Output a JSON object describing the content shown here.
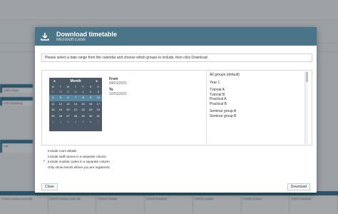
{
  "background": {
    "events": [
      {
        "text": "CSE1 Pract"
      },
      {
        "text": "CS2 Workshop"
      },
      {
        "text": "Lab"
      }
    ],
    "bottom_cells": [
      "CS101 Lecture room 4B",
      "CS102 Lecture room 4B",
      "CS103 Tutorial",
      "CS104 Practical",
      "CS105 Lecture",
      "CS106 Lecture",
      "CS107 Seminar"
    ]
  },
  "modal": {
    "title": "Download timetable",
    "subtitle": "Microsoft Excel",
    "info_text": "Please select a date range from the calendar and choose which groups to include, then click Download.",
    "calendar": {
      "month_label": "Month",
      "prev_icon": "chevron-left-icon",
      "next_icon": "chevron-right-icon",
      "dow": [
        "M",
        "T",
        "W",
        "T",
        "F",
        "S",
        "S"
      ],
      "days": [
        {
          "d": "27",
          "muted": true
        },
        {
          "d": "28",
          "muted": true
        },
        {
          "d": "29",
          "muted": true
        },
        {
          "d": "30",
          "muted": true
        },
        {
          "d": "1"
        },
        {
          "d": "2"
        },
        {
          "d": "3"
        },
        {
          "d": "4",
          "sel": true
        },
        {
          "d": "5",
          "sel": true
        },
        {
          "d": "6",
          "sel": true
        },
        {
          "d": "7",
          "sel": true
        },
        {
          "d": "8",
          "sel": true
        },
        {
          "d": "9",
          "sel": true
        },
        {
          "d": "10",
          "sel": true
        },
        {
          "d": "11"
        },
        {
          "d": "12"
        },
        {
          "d": "13"
        },
        {
          "d": "14"
        },
        {
          "d": "15"
        },
        {
          "d": "16"
        },
        {
          "d": "17"
        },
        {
          "d": "18"
        },
        {
          "d": "19"
        },
        {
          "d": "20"
        },
        {
          "d": "21"
        },
        {
          "d": "22"
        },
        {
          "d": "23"
        },
        {
          "d": "24"
        },
        {
          "d": "25"
        },
        {
          "d": "26"
        },
        {
          "d": "27"
        },
        {
          "d": "28"
        },
        {
          "d": "29"
        },
        {
          "d": "30"
        },
        {
          "d": "31"
        },
        {
          "d": "1",
          "muted": true
        },
        {
          "d": "2",
          "muted": true
        },
        {
          "d": "3",
          "muted": true
        },
        {
          "d": "4",
          "muted": true
        },
        {
          "d": "5",
          "muted": true
        },
        {
          "d": "6",
          "muted": true
        },
        {
          "d": "7",
          "muted": true
        }
      ]
    },
    "from_label": "From",
    "from_value": "04/01/2021",
    "to_label": "To",
    "to_value": "10/01/2021",
    "groups": [
      "All groups (default)",
      "Year 1",
      "Tutorial A",
      "Tutorial B",
      "Practical A",
      "Practical B",
      "Seminar group A",
      "Seminar group B"
    ],
    "options": [
      {
        "checked": false,
        "label": "Include room details"
      },
      {
        "checked": false,
        "label": "Include staff names in a separate column"
      },
      {
        "checked": true,
        "label": "Include module codes in a separate column"
      },
      {
        "checked": false,
        "label": "Only show events where you are registered"
      }
    ],
    "close_label": "Close",
    "download_label": "Download"
  },
  "colors": {
    "header_bg": "#4a7487",
    "calendar_bg": "#4b5a66",
    "calendar_selected": "#5a87a0",
    "event_accent": "#2f6e8c"
  }
}
